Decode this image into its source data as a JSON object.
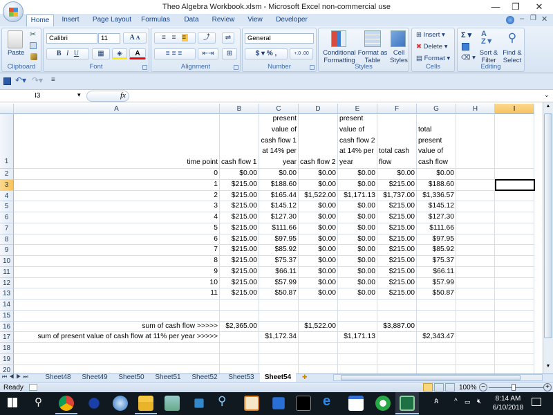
{
  "window": {
    "title": "Theo Algebra Workbook.xlsm - Microsoft Excel non-commercial use",
    "controls": {
      "minimize": "—",
      "restore": "❐",
      "close": "✕"
    }
  },
  "ribbon_tabs": [
    "Home",
    "Insert",
    "Page Layout",
    "Formulas",
    "Data",
    "Review",
    "View",
    "Developer"
  ],
  "active_tab": "Home",
  "ribbon": {
    "clipboard": {
      "label": "Clipboard",
      "paste": "Paste"
    },
    "font": {
      "label": "Font",
      "font_name": "Calibri",
      "font_size": "11",
      "bold": "B",
      "italic": "I",
      "underline": "U",
      "grow": "A",
      "shrink": "A"
    },
    "alignment": {
      "label": "Alignment"
    },
    "number": {
      "label": "Number",
      "format": "General",
      "currency": "$",
      "percent": "%",
      "comma": ",",
      "inc_decimal": "+.0 .00",
      "dec_decimal": ".00 →.0"
    },
    "styles": {
      "label": "Styles",
      "conditional": "Conditional Formatting",
      "format_table": "Format as Table",
      "cell_styles": "Cell Styles"
    },
    "cells": {
      "label": "Cells",
      "insert": "Insert",
      "delete": "Delete",
      "format": "Format"
    },
    "editing": {
      "label": "Editing",
      "sum": "Σ",
      "sort": "Sort & Filter",
      "find": "Find & Select"
    }
  },
  "formula_bar": {
    "name_box": "I3",
    "fx": "fx",
    "formula": ""
  },
  "columns": [
    "A",
    "B",
    "C",
    "D",
    "E",
    "F",
    "G",
    "H",
    "I"
  ],
  "selected_column": "I",
  "selected_row": 3,
  "selected_cell": "I3",
  "header_row": {
    "A": "time point",
    "B": "cash flow 1",
    "C": "present value of cash flow 1 at 14% per year",
    "D": "cash flow 2",
    "E": "present value of cash flow 2 at 14% per year",
    "F": "total cash flow",
    "G": "total present value of cash flow"
  },
  "rows": [
    {
      "row": 2,
      "A": "0",
      "B": "$0.00",
      "C": "$0.00",
      "D": "$0.00",
      "E": "$0.00",
      "F": "$0.00",
      "G": "$0.00"
    },
    {
      "row": 3,
      "A": "1",
      "B": "$215.00",
      "C": "$188.60",
      "D": "$0.00",
      "E": "$0.00",
      "F": "$215.00",
      "G": "$188.60"
    },
    {
      "row": 4,
      "A": "2",
      "B": "$215.00",
      "C": "$165.44",
      "D": "$1,522.00",
      "E": "$1,171.13",
      "F": "$1,737.00",
      "G": "$1,336.57"
    },
    {
      "row": 5,
      "A": "3",
      "B": "$215.00",
      "C": "$145.12",
      "D": "$0.00",
      "E": "$0.00",
      "F": "$215.00",
      "G": "$145.12"
    },
    {
      "row": 6,
      "A": "4",
      "B": "$215.00",
      "C": "$127.30",
      "D": "$0.00",
      "E": "$0.00",
      "F": "$215.00",
      "G": "$127.30"
    },
    {
      "row": 7,
      "A": "5",
      "B": "$215.00",
      "C": "$111.66",
      "D": "$0.00",
      "E": "$0.00",
      "F": "$215.00",
      "G": "$111.66"
    },
    {
      "row": 8,
      "A": "6",
      "B": "$215.00",
      "C": "$97.95",
      "D": "$0.00",
      "E": "$0.00",
      "F": "$215.00",
      "G": "$97.95"
    },
    {
      "row": 9,
      "A": "7",
      "B": "$215.00",
      "C": "$85.92",
      "D": "$0.00",
      "E": "$0.00",
      "F": "$215.00",
      "G": "$85.92"
    },
    {
      "row": 10,
      "A": "8",
      "B": "$215.00",
      "C": "$75.37",
      "D": "$0.00",
      "E": "$0.00",
      "F": "$215.00",
      "G": "$75.37"
    },
    {
      "row": 11,
      "A": "9",
      "B": "$215.00",
      "C": "$66.11",
      "D": "$0.00",
      "E": "$0.00",
      "F": "$215.00",
      "G": "$66.11"
    },
    {
      "row": 12,
      "A": "10",
      "B": "$215.00",
      "C": "$57.99",
      "D": "$0.00",
      "E": "$0.00",
      "F": "$215.00",
      "G": "$57.99"
    },
    {
      "row": 13,
      "A": "11",
      "B": "$215.00",
      "C": "$50.87",
      "D": "$0.00",
      "E": "$0.00",
      "F": "$215.00",
      "G": "$50.87"
    },
    {
      "row": 14
    },
    {
      "row": 15
    },
    {
      "row": 16,
      "A": "sum of cash flow >>>>>",
      "B": "$2,365.00",
      "D": "$1,522.00",
      "F": "$3,887.00"
    },
    {
      "row": 17,
      "A": "sum of present value of cash flow at 11% per year >>>>>",
      "C": "$1,172.34",
      "E": "$1,171.13",
      "G": "$2,343.47"
    },
    {
      "row": 18
    },
    {
      "row": 19
    },
    {
      "row": 20
    }
  ],
  "sheet_tabs": [
    "Sheet48",
    "Sheet49",
    "Sheet50",
    "Sheet51",
    "Sheet52",
    "Sheet53",
    "Sheet54"
  ],
  "active_sheet": "Sheet54",
  "status_bar": {
    "mode": "Ready",
    "zoom": "100%"
  },
  "taskbar": {
    "apps": [
      "start",
      "search",
      "chrome",
      "app-blue-circle",
      "thunderbird",
      "file-explorer",
      "app-image",
      "app-settings",
      "magnifier",
      "app-orange",
      "app-blue",
      "terminal",
      "edge",
      "calendar",
      "app-green",
      "excel"
    ],
    "time": "8:14 AM",
    "date": "6/10/2018"
  }
}
